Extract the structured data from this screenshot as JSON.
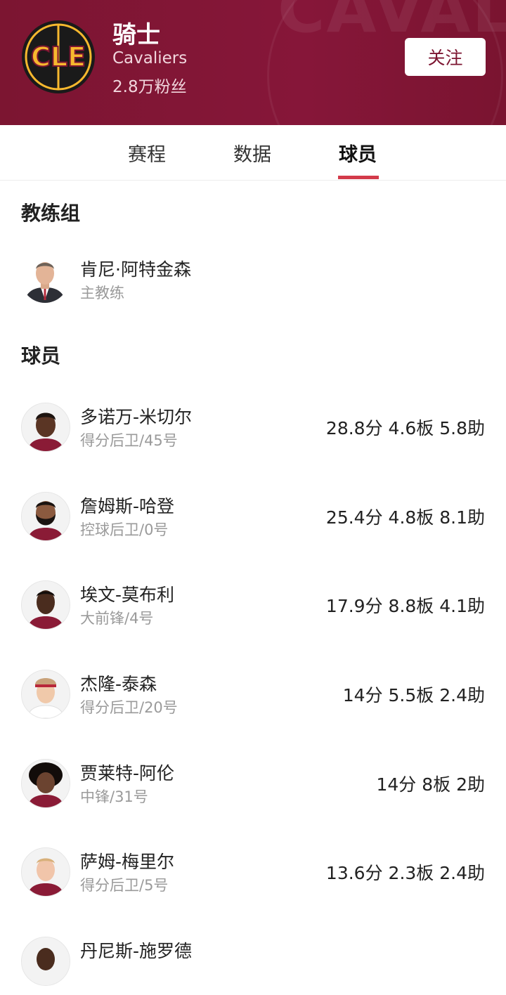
{
  "header": {
    "team_name": "骑士",
    "team_en": "Cavaliers",
    "fans": "2.8万粉丝",
    "follow_label": "关注",
    "logo_text": "CLE",
    "watermark_text": "CAVALIERS",
    "colors": {
      "primary": "#7c1531",
      "logo_gold": "#f7b82e",
      "accent": "#d33a4a"
    }
  },
  "tabs": [
    {
      "label": "赛程",
      "active": false
    },
    {
      "label": "数据",
      "active": false
    },
    {
      "label": "球员",
      "active": true
    }
  ],
  "coaches": {
    "title": "教练组",
    "items": [
      {
        "name": "肯尼·阿特金森",
        "role": "主教练"
      }
    ]
  },
  "players": {
    "title": "球员",
    "items": [
      {
        "name": "多诺万-米切尔",
        "position": "得分后卫/45号",
        "stats": "28.8分 4.6板 5.8助"
      },
      {
        "name": "詹姆斯-哈登",
        "position": "控球后卫/0号",
        "stats": "25.4分 4.8板 8.1助"
      },
      {
        "name": "埃文-莫布利",
        "position": "大前锋/4号",
        "stats": "17.9分 8.8板 4.1助"
      },
      {
        "name": "杰隆-泰森",
        "position": "得分后卫/20号",
        "stats": "14分 5.5板 2.4助"
      },
      {
        "name": "贾莱特-阿伦",
        "position": "中锋/31号",
        "stats": "14分 8板 2助"
      },
      {
        "name": "萨姆-梅里尔",
        "position": "得分后卫/5号",
        "stats": "13.6分 2.3板 2.4助"
      },
      {
        "name": "丹尼斯-施罗德",
        "position": "",
        "stats": ""
      }
    ]
  }
}
